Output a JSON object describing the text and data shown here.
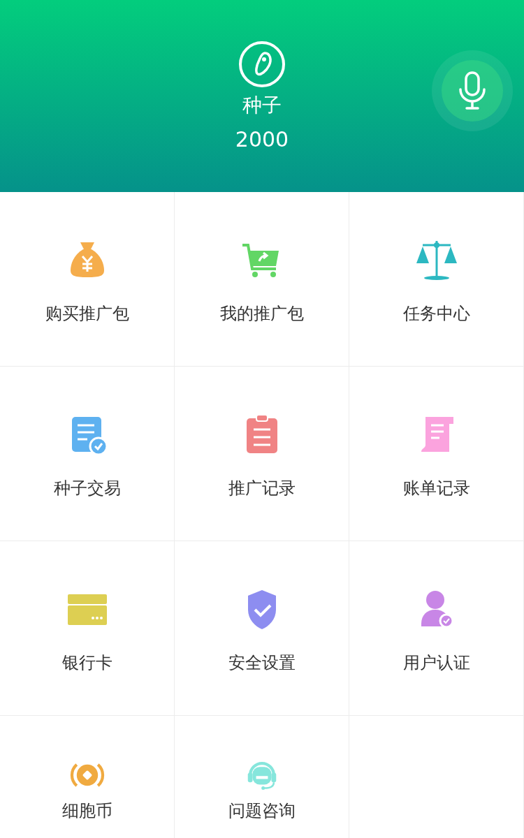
{
  "header": {
    "title": "种子",
    "amount": "2000"
  },
  "menu": [
    {
      "label": "购买推广包"
    },
    {
      "label": "我的推广包"
    },
    {
      "label": "任务中心"
    },
    {
      "label": "种子交易"
    },
    {
      "label": "推广记录"
    },
    {
      "label": "账单记录"
    },
    {
      "label": "银行卡"
    },
    {
      "label": "安全设置"
    },
    {
      "label": "用户认证"
    },
    {
      "label": "细胞币"
    },
    {
      "label": "问题咨询"
    }
  ]
}
